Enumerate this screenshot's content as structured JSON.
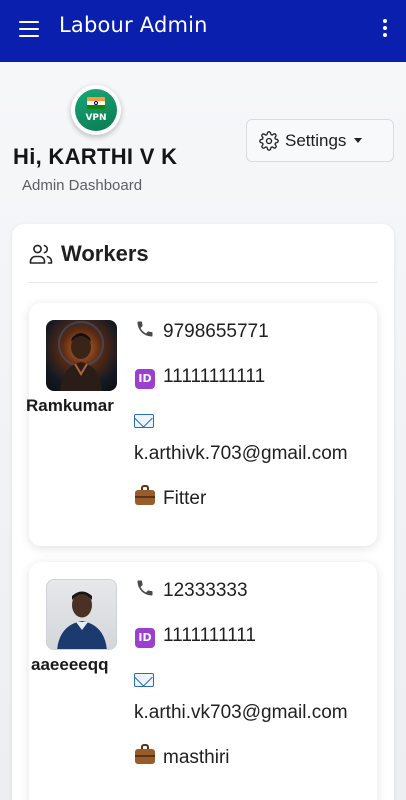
{
  "app_bar": {
    "title": "Labour Admin"
  },
  "profile": {
    "logo_text": "VPN",
    "greeting": "Hi, KARTHI V K",
    "subtitle": "Admin Dashboard"
  },
  "settings_button": {
    "label": "Settings"
  },
  "workers_panel": {
    "title": "Workers",
    "workers": [
      {
        "name": "Ramkumar",
        "phone": "9798655771",
        "id": "11111111111",
        "email": "k.arthivk.703@gmail.com",
        "role": "Fitter"
      },
      {
        "name": "aaeeeeqq",
        "phone": "12333333",
        "id": "1111111111",
        "email": "k.arthi.vk703@gmail.com",
        "role": "masthiri"
      }
    ]
  },
  "icons": {
    "menu": "menu-icon",
    "more": "more-vertical-icon",
    "settings": "gear-icon",
    "workers": "people-icon",
    "phone": "phone-icon",
    "id": "id-badge-icon",
    "email": "email-icon",
    "role": "briefcase-icon"
  },
  "colors": {
    "app_bar": "#0a1fae",
    "logo_green": "#18a878",
    "id_badge": "#9b3fd1"
  }
}
